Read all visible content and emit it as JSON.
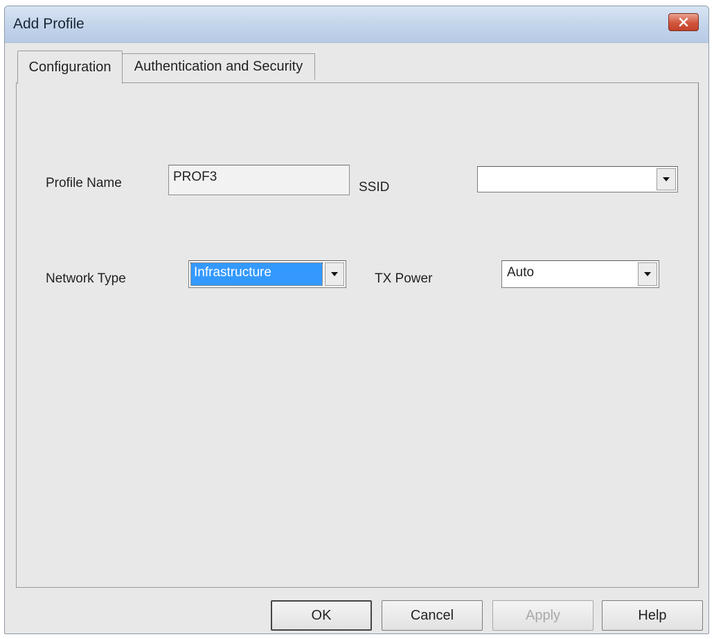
{
  "window": {
    "title": "Add Profile"
  },
  "tabs": [
    {
      "label": "Configuration",
      "active": true
    },
    {
      "label": "Authentication and Security",
      "active": false
    }
  ],
  "form": {
    "profile_name": {
      "label": "Profile Name",
      "value": "PROF3"
    },
    "ssid": {
      "label": "SSID",
      "value": ""
    },
    "network_type": {
      "label": "Network Type",
      "value": "Infrastructure"
    },
    "tx_power": {
      "label": "TX Power",
      "value": "Auto"
    }
  },
  "buttons": {
    "ok": "OK",
    "cancel": "Cancel",
    "apply": "Apply",
    "help": "Help"
  },
  "colors": {
    "selection": "#3399ff",
    "close_button": "#d2553c",
    "dialog_bg": "#e8e8e8"
  },
  "icons": {
    "close": "close-icon",
    "dropdown": "chevron-down-icon"
  }
}
